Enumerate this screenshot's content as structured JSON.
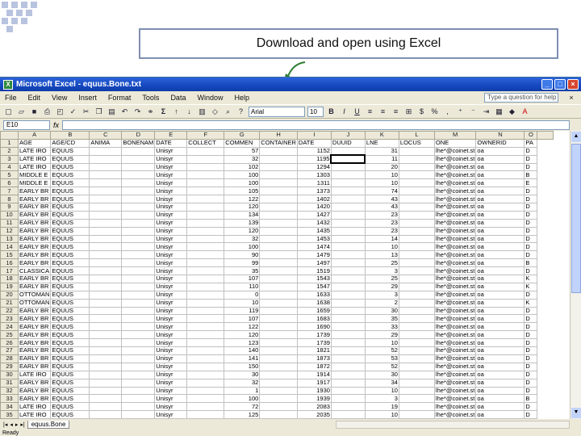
{
  "callout": {
    "text": "Download and open using Excel"
  },
  "window": {
    "title": "Microsoft Excel - equus.Bone.txt",
    "menu": [
      "File",
      "Edit",
      "View",
      "Insert",
      "Format",
      "Tools",
      "Data",
      "Window",
      "Help"
    ],
    "help_placeholder": "Type a question for help",
    "font": "Arial",
    "font_size": "10",
    "name_box": "E10"
  },
  "sheet": {
    "columns": [
      "A",
      "B",
      "C",
      "D",
      "E",
      "F",
      "G",
      "H",
      "I",
      "J",
      "K",
      "L",
      "M",
      "N",
      "O"
    ],
    "rows": [
      [
        "1",
        "AGE",
        "AGE/CD",
        "ANIMA",
        "BONENAM",
        "DATE",
        "COLLECT",
        "COMMEN",
        "CONTAINER",
        "DATE",
        "DUUID",
        "LNE",
        "LOCUS",
        "ONE",
        "OWNERID",
        "PA"
      ],
      [
        "2",
        "LATE IRO",
        "EQUUS",
        "",
        "",
        "Unisyr",
        "",
        "57",
        "",
        "1152",
        "",
        "31",
        "",
        "lhe*@coinet.st",
        "oa",
        "D"
      ],
      [
        "3",
        "LATE IRO",
        "EQUUS",
        "",
        "",
        "Unisyr",
        "",
        "32",
        "",
        "1195",
        "",
        "11",
        "",
        "lhe*@coinet.st",
        "oa",
        "D"
      ],
      [
        "4",
        "LATE IRO",
        "EQUUS",
        "",
        "",
        "Unisyr",
        "",
        "102",
        "",
        "1294",
        "",
        "20",
        "",
        "lhe*@coinet.st",
        "oa",
        "D"
      ],
      [
        "5",
        "MIDDLE E",
        "EQUUS",
        "",
        "",
        "Unisyr",
        "",
        "100",
        "",
        "1303",
        "",
        "10",
        "",
        "lhe*@coinet.st",
        "oa",
        "B"
      ],
      [
        "6",
        "MIDDLE E",
        "EQUUS",
        "",
        "",
        "Unisyr",
        "",
        "100",
        "",
        "1311",
        "",
        "10",
        "",
        "lhe*@coinet.st",
        "oa",
        "E"
      ],
      [
        "7",
        "EARLY BR",
        "EQUUS",
        "",
        "",
        "Unisyr",
        "",
        "105",
        "",
        "1373",
        "",
        "74",
        "",
        "lhe*@coinet.st",
        "oa",
        "D"
      ],
      [
        "8",
        "EARLY BR",
        "EQUUS",
        "",
        "",
        "Unisyr",
        "",
        "122",
        "",
        "1402",
        "",
        "43",
        "",
        "lhe*@coinet.st",
        "oa",
        "D"
      ],
      [
        "9",
        "EARLY BR",
        "EQUUS",
        "",
        "",
        "Unisyr",
        "",
        "120",
        "",
        "1420",
        "",
        "43",
        "",
        "lhe*@coinet.st",
        "oa",
        "D"
      ],
      [
        "10",
        "EARLY BR",
        "EQUUS",
        "",
        "",
        "Unisyr",
        "",
        "134",
        "",
        "1427",
        "",
        "23",
        "",
        "lhe*@coinet.st",
        "oa",
        "D"
      ],
      [
        "11",
        "EARLY BR",
        "EQUUS",
        "",
        "",
        "Unisyr",
        "",
        "139",
        "",
        "1432",
        "",
        "23",
        "",
        "lhe*@coinet.st",
        "oa",
        "D"
      ],
      [
        "12",
        "EARLY BR",
        "EQUUS",
        "",
        "",
        "Unisyr",
        "",
        "120",
        "",
        "1435",
        "",
        "23",
        "",
        "lhe*@coinet.st",
        "oa",
        "D"
      ],
      [
        "13",
        "EARLY BR",
        "EQUUS",
        "",
        "",
        "Unisyr",
        "",
        "32",
        "",
        "1453",
        "",
        "14",
        "",
        "lhe*@coinet.st",
        "oa",
        "D"
      ],
      [
        "14",
        "EARLY BR",
        "EQUUS",
        "",
        "",
        "Unisyr",
        "",
        "100",
        "",
        "1474",
        "",
        "10",
        "",
        "lhe*@coinet.st",
        "oa",
        "D"
      ],
      [
        "15",
        "EARLY BR",
        "EQUUS",
        "",
        "",
        "Unisyr",
        "",
        "90",
        "",
        "1479",
        "",
        "13",
        "",
        "lhe*@coinet.st",
        "oa",
        "D"
      ],
      [
        "16",
        "EARLY BR",
        "EQUUS",
        "",
        "",
        "Unisyr",
        "",
        "99",
        "",
        "1497",
        "",
        "25",
        "",
        "lhe*@coinet.st",
        "oa",
        "B"
      ],
      [
        "17",
        "CLASSICA",
        "EQUUS",
        "",
        "",
        "Unisyr",
        "",
        "35",
        "",
        "1519",
        "",
        "3",
        "",
        "lhe*@coinet.st",
        "oa",
        "D"
      ],
      [
        "18",
        "EARLY BR",
        "EQUUS",
        "",
        "",
        "Unisyr",
        "",
        "107",
        "",
        "1543",
        "",
        "25",
        "",
        "lhe*@coinet.st",
        "oa",
        "K"
      ],
      [
        "19",
        "EARLY BR",
        "EQUUS",
        "",
        "",
        "Unisyr",
        "",
        "110",
        "",
        "1547",
        "",
        "29",
        "",
        "lhe*@coinet.st",
        "oa",
        "K"
      ],
      [
        "20",
        "OTTOMAN",
        "EQUUS",
        "",
        "",
        "Unisyr",
        "",
        "0",
        "",
        "1633",
        "",
        "3",
        "",
        "lhe*@coinet.st",
        "oa",
        "D"
      ],
      [
        "21",
        "OTTOMAN",
        "EQUUS",
        "",
        "",
        "Unisyr",
        "",
        "10",
        "",
        "1638",
        "",
        "2",
        "",
        "lhe*@coinet.st",
        "oa",
        "K"
      ],
      [
        "22",
        "EARLY BR",
        "EQUUS",
        "",
        "",
        "Unisyr",
        "",
        "119",
        "",
        "1659",
        "",
        "30",
        "",
        "lhe*@coinet.st",
        "oa",
        "D"
      ],
      [
        "23",
        "EARLY BR",
        "EQUUS",
        "",
        "",
        "Unisyr",
        "",
        "107",
        "",
        "1683",
        "",
        "35",
        "",
        "lhe*@coinet.st",
        "oa",
        "D"
      ],
      [
        "24",
        "EARLY BR",
        "EQUUS",
        "",
        "",
        "Unisyr",
        "",
        "122",
        "",
        "1690",
        "",
        "33",
        "",
        "lhe*@coinet.st",
        "oa",
        "D"
      ],
      [
        "25",
        "EARLY BR",
        "EQUUS",
        "",
        "",
        "Unisyr",
        "",
        "120",
        "",
        "1739",
        "",
        "29",
        "",
        "lhe*@coinet.st",
        "oa",
        "D"
      ],
      [
        "26",
        "EARLY BR",
        "EQUUS",
        "",
        "",
        "Unisyr",
        "",
        "123",
        "",
        "1739",
        "",
        "10",
        "",
        "lhe*@coinet.st",
        "oa",
        "D"
      ],
      [
        "27",
        "EARLY BR",
        "EQUUS",
        "",
        "",
        "Unisyr",
        "",
        "140",
        "",
        "1821",
        "",
        "52",
        "",
        "lhe*@coinet.st",
        "oa",
        "D"
      ],
      [
        "28",
        "EARLY BR",
        "EQUUS",
        "",
        "",
        "Unisyr",
        "",
        "141",
        "",
        "1873",
        "",
        "53",
        "",
        "lhe*@coinet.st",
        "oa",
        "D"
      ],
      [
        "29",
        "EARLY BR",
        "EQUUS",
        "",
        "",
        "Unisyr",
        "",
        "150",
        "",
        "1872",
        "",
        "52",
        "",
        "lhe*@coinet.st",
        "oa",
        "D"
      ],
      [
        "30",
        "LATE IRO",
        "EQUUS",
        "",
        "",
        "Unisyr",
        "",
        "30",
        "",
        "1914",
        "",
        "30",
        "",
        "lhe*@coinet.st",
        "oa",
        "D"
      ],
      [
        "31",
        "EARLY BR",
        "EQUUS",
        "",
        "",
        "Unisyr",
        "",
        "32",
        "",
        "1917",
        "",
        "34",
        "",
        "lhe*@coinet.st",
        "oa",
        "D"
      ],
      [
        "32",
        "EARLY BR",
        "EQUUS",
        "",
        "",
        "Unisyr",
        "",
        "1",
        "",
        "1930",
        "",
        "10",
        "",
        "lhe*@coinet.st",
        "oa",
        "D"
      ],
      [
        "33",
        "EARLY BR",
        "EQUUS",
        "",
        "",
        "Unisyr",
        "",
        "100",
        "",
        "1939",
        "",
        "3",
        "",
        "lhe*@coinet.st",
        "oa",
        "B"
      ],
      [
        "34",
        "LATE IRO",
        "EQUUS",
        "",
        "",
        "Unisyr",
        "",
        "72",
        "",
        "2083",
        "",
        "19",
        "",
        "lhe*@coinet.st",
        "oa",
        "D"
      ],
      [
        "35",
        "LATE IRO",
        "EQUUS",
        "",
        "",
        "Unisyr",
        "",
        "125",
        "",
        "2035",
        "",
        "10",
        "",
        "lhe*@coinet.st",
        "oa",
        "D"
      ]
    ]
  },
  "tabs": {
    "sheet_name": "equus.Bone"
  },
  "status": {
    "text": "Ready"
  }
}
